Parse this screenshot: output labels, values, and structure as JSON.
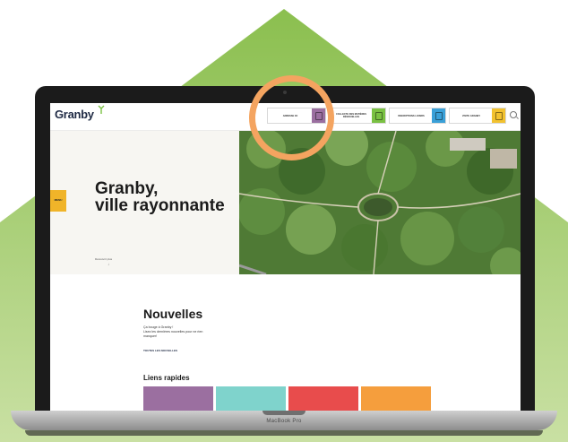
{
  "colors": {
    "green_bg": "#8bbf4f",
    "green_bg_light": "#c4dc9c",
    "ring": "#f4a460",
    "logo_text": "#1f2a44",
    "menu_tab": "#f0b429"
  },
  "header": {
    "logo": "Granby",
    "nav": [
      {
        "label": "ADRESSE ICI",
        "color": "#9b6fa0",
        "icon": "alert-icon"
      },
      {
        "label": "COLLECTE DES MATIÈRES RÉSIDUELLES",
        "color": "#7ac143",
        "icon": "recycle-icon"
      },
      {
        "label": "INSCRIPTIONS LOISIRS",
        "color": "#3aa0d8",
        "icon": "calendar-icon"
      },
      {
        "label": "VISITE GRANBY",
        "color": "#f2c230",
        "icon": "suitcase-icon"
      }
    ],
    "search_icon": "search-icon"
  },
  "hero": {
    "menu_label": "MENU",
    "title_line1": "Granby,",
    "title_line2": "ville rayonnante",
    "more": "Découvrir plus",
    "arrow": "↓"
  },
  "news": {
    "title": "Nouvelles",
    "text_line1": "Ça bouge à Granby !",
    "text_line2": "Lisez les dernières nouvelles pour ne rien manquer!",
    "link": "TOUTES LES NOUVELLES"
  },
  "quick_links": {
    "title": "Liens rapides",
    "tiles": [
      {
        "color": "#9b6fa0"
      },
      {
        "color": "#7fd3cc"
      },
      {
        "color": "#e84c4c"
      },
      {
        "color": "#f59e3d"
      }
    ]
  },
  "device": {
    "label": "MacBook Pro"
  }
}
